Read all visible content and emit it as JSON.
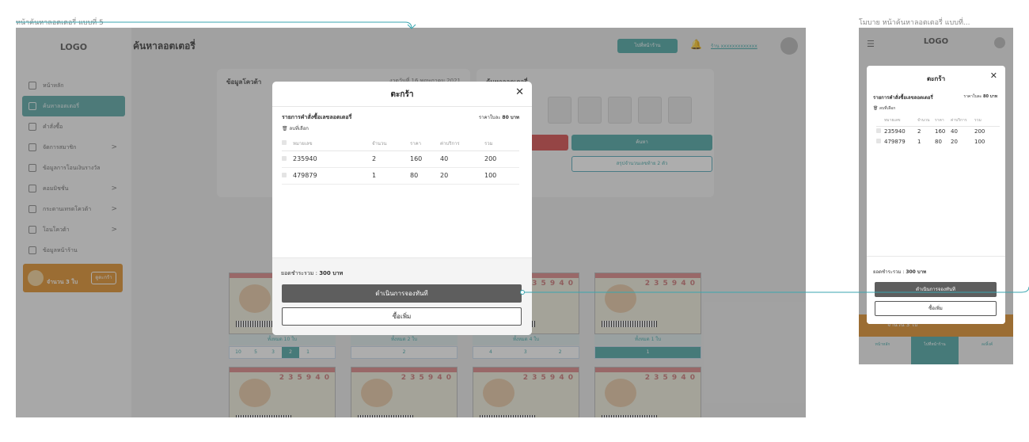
{
  "labels": {
    "desktop": "หน้าค้นหาลอตเตอรี่ แบบที่ 5",
    "mobile": "โมบาย หน้าค้นหาลอตเตอรี่ แบบที่..."
  },
  "sidebar": {
    "logo": "LOGO",
    "items": [
      {
        "label": "หน้าหลัก",
        "chevron": ""
      },
      {
        "label": "ค้นหาลอตเตอรี่",
        "chevron": ""
      },
      {
        "label": "คำสั่งซื้อ",
        "chevron": ""
      },
      {
        "label": "จัดการสมาชิก",
        "chevron": ">"
      },
      {
        "label": "ข้อมูลการโอนเงินรางวัล",
        "chevron": ""
      },
      {
        "label": "คอมมิชชั่น",
        "chevron": ">"
      },
      {
        "label": "กระดานเทรดโควต้า",
        "chevron": ">"
      },
      {
        "label": "โอนโควต้า",
        "chevron": ">"
      },
      {
        "label": "ข้อมูลหน้าร้าน",
        "chevron": ""
      }
    ],
    "cart_count": "จำนวน 3 ใบ",
    "cart_button": "ดูตะกร้า"
  },
  "header": {
    "title": "ค้นหาลอตเตอรี่",
    "shop_button": "ไปที่หน้าร้าน",
    "user": "ร้าน xxxxxxxxxxxxx"
  },
  "panels": {
    "left_title": "ข้อมูลโควต้า",
    "left_date": "งวดวันที่ 16 พฤษภาคม 2021",
    "right_title": "ค้นหาลอตเตอรี่",
    "search_btn": "ค้นหา",
    "outline_btn": "สรุปจำนวนเลขท้าย 2 ตัว"
  },
  "tickets": {
    "number": "2 3 5 9 4 0",
    "sets": [
      "ทั้งหมด 10 ใบ",
      "ทั้งหมด 2 ใบ",
      "ทั้งหมด 4 ใบ",
      "ทั้งหมด 1 ใบ"
    ]
  },
  "modal": {
    "title": "ตะกร้า",
    "close": "✕",
    "subtitle": "รายการคำสั่งซื้อเลขลอตเตอรี่",
    "price_label": "ราคาใบละ",
    "price_value": "80 บาท",
    "delete": "🗑 ลบที่เลือก",
    "columns": [
      "หมายเลข",
      "จำนวน",
      "ราคา",
      "ค่าบริการ",
      "รวม"
    ],
    "rows": [
      [
        "235940",
        "2",
        "160",
        "40",
        "200"
      ],
      [
        "479879",
        "1",
        "80",
        "20",
        "100"
      ]
    ],
    "total_label": "ยอดชำระรวม :",
    "total_value": "300 บาท",
    "book_btn": "ดำเนินการจองทันที",
    "more_btn": "ซื้อเพิ่ม"
  },
  "mobile": {
    "logo": "LOGO",
    "cart": "จำนวน 3 ใบ",
    "nav": [
      "หน้าหลัก",
      "ไปที่หน้าร้าน",
      "ลงลิ้งค์"
    ]
  },
  "colors": {
    "accent": "#4fa8a5",
    "dark_button": "#5e5e5e",
    "orange": "#e0912e"
  }
}
